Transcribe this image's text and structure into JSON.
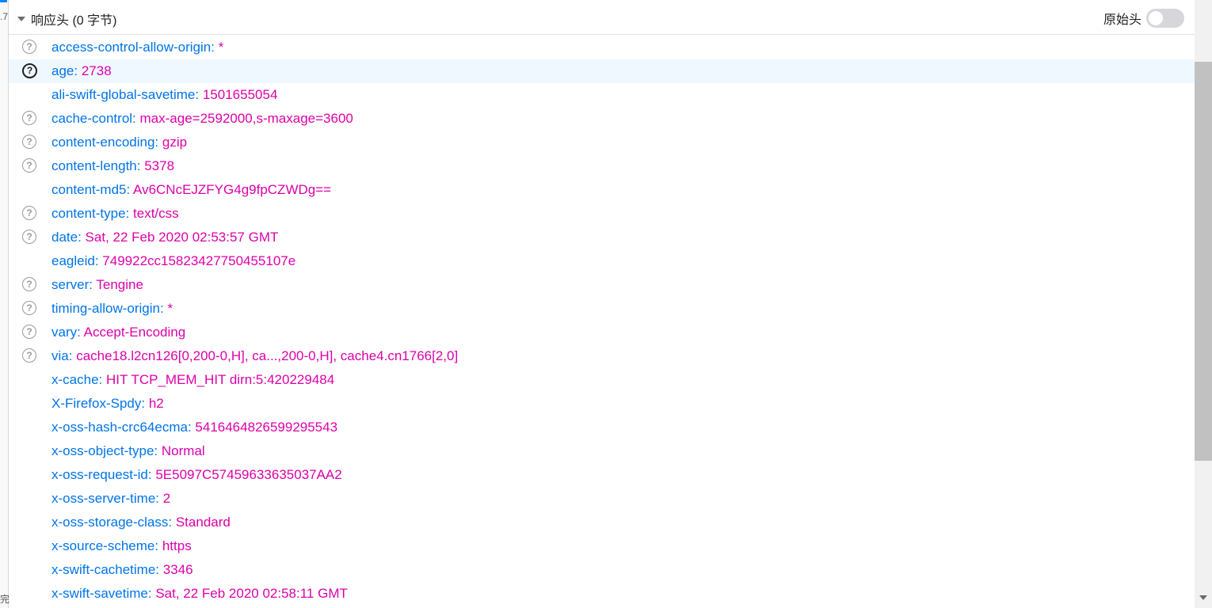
{
  "header": {
    "title": "响应头 (0 字节)",
    "raw_label": "原始头",
    "raw_toggle_on": false
  },
  "gutter": {
    "fragment_top": ".7",
    "fragment_bottom": "完"
  },
  "help_icon_glyph": "?",
  "headers": [
    {
      "name": "access-control-allow-origin:",
      "value": "*",
      "help": true
    },
    {
      "name": "age:",
      "value": "2738",
      "help": true,
      "highlighted": true
    },
    {
      "name": "ali-swift-global-savetime:",
      "value": "1501655054",
      "help": false
    },
    {
      "name": "cache-control:",
      "value": "max-age=2592000,s-maxage=3600",
      "help": true
    },
    {
      "name": "content-encoding:",
      "value": "gzip",
      "help": true
    },
    {
      "name": "content-length:",
      "value": "5378",
      "help": true
    },
    {
      "name": "content-md5:",
      "value": "Av6CNcEJZFYG4g9fpCZWDg==",
      "help": false
    },
    {
      "name": "content-type:",
      "value": "text/css",
      "help": true
    },
    {
      "name": "date:",
      "value": "Sat, 22 Feb 2020 02:53:57 GMT",
      "help": true
    },
    {
      "name": "eagleid:",
      "value": "749922cc15823427750455107e",
      "help": false
    },
    {
      "name": "server:",
      "value": "Tengine",
      "help": true
    },
    {
      "name": "timing-allow-origin:",
      "value": "*",
      "help": true
    },
    {
      "name": "vary:",
      "value": "Accept-Encoding",
      "help": true
    },
    {
      "name": "via:",
      "value": "cache18.l2cn126[0,200-0,H], ca...,200-0,H], cache4.cn1766[2,0]",
      "help": true
    },
    {
      "name": "x-cache:",
      "value": "HIT TCP_MEM_HIT dirn:5:420229484",
      "help": false
    },
    {
      "name": "X-Firefox-Spdy:",
      "value": "h2",
      "help": false
    },
    {
      "name": "x-oss-hash-crc64ecma:",
      "value": "5416464826599295543",
      "help": false
    },
    {
      "name": "x-oss-object-type:",
      "value": "Normal",
      "help": false
    },
    {
      "name": "x-oss-request-id:",
      "value": "5E5097C57459633635037AA2",
      "help": false
    },
    {
      "name": "x-oss-server-time:",
      "value": "2",
      "help": false
    },
    {
      "name": "x-oss-storage-class:",
      "value": "Standard",
      "help": false
    },
    {
      "name": "x-source-scheme:",
      "value": "https",
      "help": false
    },
    {
      "name": "x-swift-cachetime:",
      "value": "3346",
      "help": false
    },
    {
      "name": "x-swift-savetime:",
      "value": "Sat, 22 Feb 2020 02:58:11 GMT",
      "help": false
    }
  ]
}
